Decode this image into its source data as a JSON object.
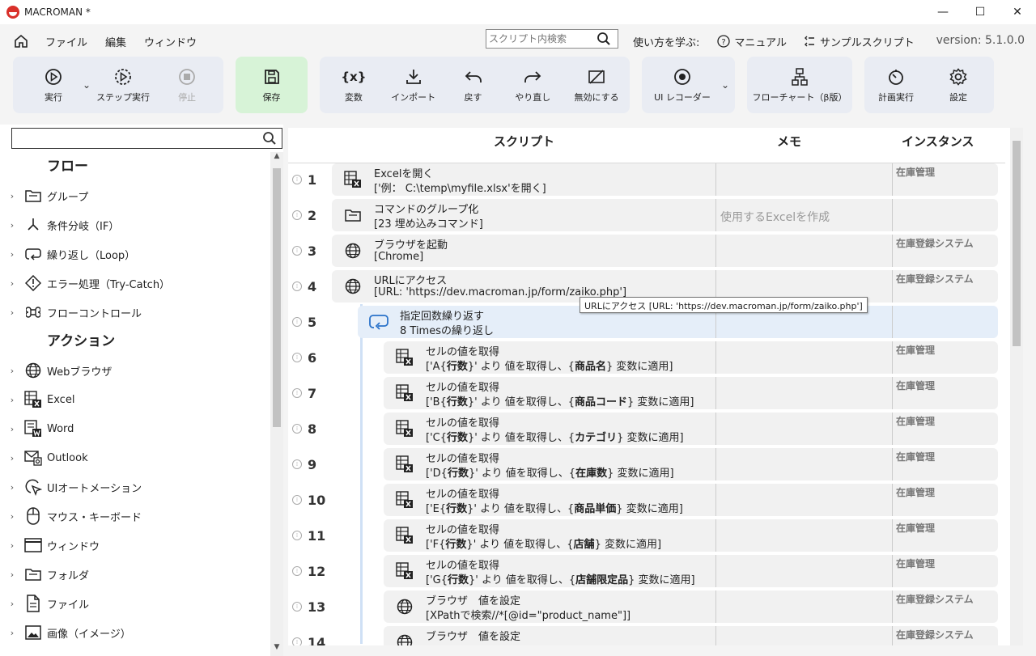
{
  "window": {
    "title": "MACROMAN *",
    "minimize": "—",
    "maximize": "☐",
    "close": "✕"
  },
  "menu": {
    "items": [
      "ファイル",
      "編集",
      "ウィンドウ"
    ],
    "search_placeholder": "スクリプト内検索",
    "learn": "使い方を学ぶ:",
    "manual": "マニュアル",
    "sample": "サンプルスクリプト",
    "version": "version: 5.1.0.0"
  },
  "toolbar": {
    "run": "実行",
    "step": "ステップ実行",
    "stop": "停止",
    "save": "保存",
    "variable": "変数",
    "import": "インポート",
    "undo": "戻す",
    "redo": "やり直し",
    "disable": "無効にする",
    "ui_recorder": "UI レコーダー",
    "flowchart": "フローチャート（β版）",
    "schedule": "計画実行",
    "settings": "設定",
    "variable_glyph": "{x}"
  },
  "sidebar": {
    "search_value": "",
    "flow_title": "フロー",
    "flow_items": [
      {
        "label": "グループ",
        "icon": "folder-icon"
      },
      {
        "label": "条件分岐（IF）",
        "icon": "branch-icon"
      },
      {
        "label": "繰り返し（Loop）",
        "icon": "loop-icon"
      },
      {
        "label": "エラー処理（Try-Catch）",
        "icon": "warning-diamond-icon"
      },
      {
        "label": "フローコントロール",
        "icon": "command-icon"
      }
    ],
    "action_title": "アクション",
    "action_items": [
      {
        "label": "Webブラウザ",
        "icon": "globe-icon"
      },
      {
        "label": "Excel",
        "icon": "excel-icon"
      },
      {
        "label": "Word",
        "icon": "word-icon"
      },
      {
        "label": "Outlook",
        "icon": "mail-icon"
      },
      {
        "label": "UIオートメーション",
        "icon": "cursor-icon"
      },
      {
        "label": "マウス・キーボード",
        "icon": "mouse-icon"
      },
      {
        "label": "ウィンドウ",
        "icon": "window-icon"
      },
      {
        "label": "フォルダ",
        "icon": "folder-icon"
      },
      {
        "label": "ファイル",
        "icon": "file-icon"
      },
      {
        "label": "画像（イメージ）",
        "icon": "image-icon"
      }
    ]
  },
  "script": {
    "headers": {
      "script": "スクリプト",
      "memo": "メモ",
      "instance": "インスタンス"
    },
    "rows": [
      {
        "num": "1",
        "icon": "excel-icon",
        "t1": "Excelを開く",
        "t2": "['例： C:\\temp\\myfile.xlsx'を開く]",
        "memo": "",
        "instance": "在庫管理",
        "indent": 0
      },
      {
        "num": "2",
        "icon": "folder-icon",
        "t1": "コマンドのグループ化",
        "t2": "[23 埋め込みコマンド]",
        "memo": "使用するExcelを作成",
        "instance": "",
        "indent": 0
      },
      {
        "num": "3",
        "icon": "globe-icon",
        "t1": "ブラウザを起動",
        "t2": "[Chrome]",
        "memo": "",
        "instance": "在庫登録システム",
        "indent": 0
      },
      {
        "num": "4",
        "icon": "globe-icon",
        "t1": "URLにアクセス",
        "t2": "[URL: 'https://dev.macroman.jp/form/zaiko.php']",
        "memo": "",
        "instance": "在庫登録システム",
        "indent": 0
      },
      {
        "num": "5",
        "icon": "loop-icon",
        "t1": "指定回数繰り返す",
        "t2": "8 Timesの繰り返し",
        "memo": "",
        "instance": "",
        "indent": 1,
        "selected": true
      },
      {
        "num": "6",
        "icon": "excel-icon",
        "t1": "セルの値を取得",
        "t2a": "['A{",
        "t2b": "行数",
        "t2c": "}' より 値を取得し、{",
        "t2d": "商品名",
        "t2e": "} 変数に適用]",
        "memo": "",
        "instance": "在庫管理",
        "indent": 2
      },
      {
        "num": "7",
        "icon": "excel-icon",
        "t1": "セルの値を取得",
        "t2a": "['B{",
        "t2b": "行数",
        "t2c": "}' より 値を取得し、{",
        "t2d": "商品コード",
        "t2e": "} 変数に適用]",
        "memo": "",
        "instance": "在庫管理",
        "indent": 2
      },
      {
        "num": "8",
        "icon": "excel-icon",
        "t1": "セルの値を取得",
        "t2a": "['C{",
        "t2b": "行数",
        "t2c": "}' より 値を取得し、{",
        "t2d": "カテゴリ",
        "t2e": "} 変数に適用]",
        "memo": "",
        "instance": "在庫管理",
        "indent": 2
      },
      {
        "num": "9",
        "icon": "excel-icon",
        "t1": "セルの値を取得",
        "t2a": "['D{",
        "t2b": "行数",
        "t2c": "}' より 値を取得し、{",
        "t2d": "在庫数",
        "t2e": "} 変数に適用]",
        "memo": "",
        "instance": "在庫管理",
        "indent": 2
      },
      {
        "num": "10",
        "icon": "excel-icon",
        "t1": "セルの値を取得",
        "t2a": "['E{",
        "t2b": "行数",
        "t2c": "}' より 値を取得し、{",
        "t2d": "商品単価",
        "t2e": "} 変数に適用]",
        "memo": "",
        "instance": "在庫管理",
        "indent": 2
      },
      {
        "num": "11",
        "icon": "excel-icon",
        "t1": "セルの値を取得",
        "t2a": "['F{",
        "t2b": "行数",
        "t2c": "}' より 値を取得し、{",
        "t2d": "店舗",
        "t2e": "} 変数に適用]",
        "memo": "",
        "instance": "在庫管理",
        "indent": 2
      },
      {
        "num": "12",
        "icon": "excel-icon",
        "t1": "セルの値を取得",
        "t2a": "['G{",
        "t2b": "行数",
        "t2c": "}' より 値を取得し、{",
        "t2d": "店舗限定品",
        "t2e": "} 変数に適用]",
        "memo": "",
        "instance": "在庫管理",
        "indent": 2
      },
      {
        "num": "13",
        "icon": "globe-icon",
        "t1": "ブラウザ　値を設定",
        "t2": "[XPathで検索//*[@id=\"product_name\"]]",
        "memo": "",
        "instance": "在庫登録システム",
        "indent": 2
      },
      {
        "num": "14",
        "icon": "globe-icon",
        "t1": "ブラウザ　値を設定",
        "t2": "",
        "memo": "",
        "instance": "在庫登録システム",
        "indent": 2
      }
    ],
    "tooltip": "URLにアクセス [URL: 'https://dev.macroman.jp/form/zaiko.php']"
  }
}
